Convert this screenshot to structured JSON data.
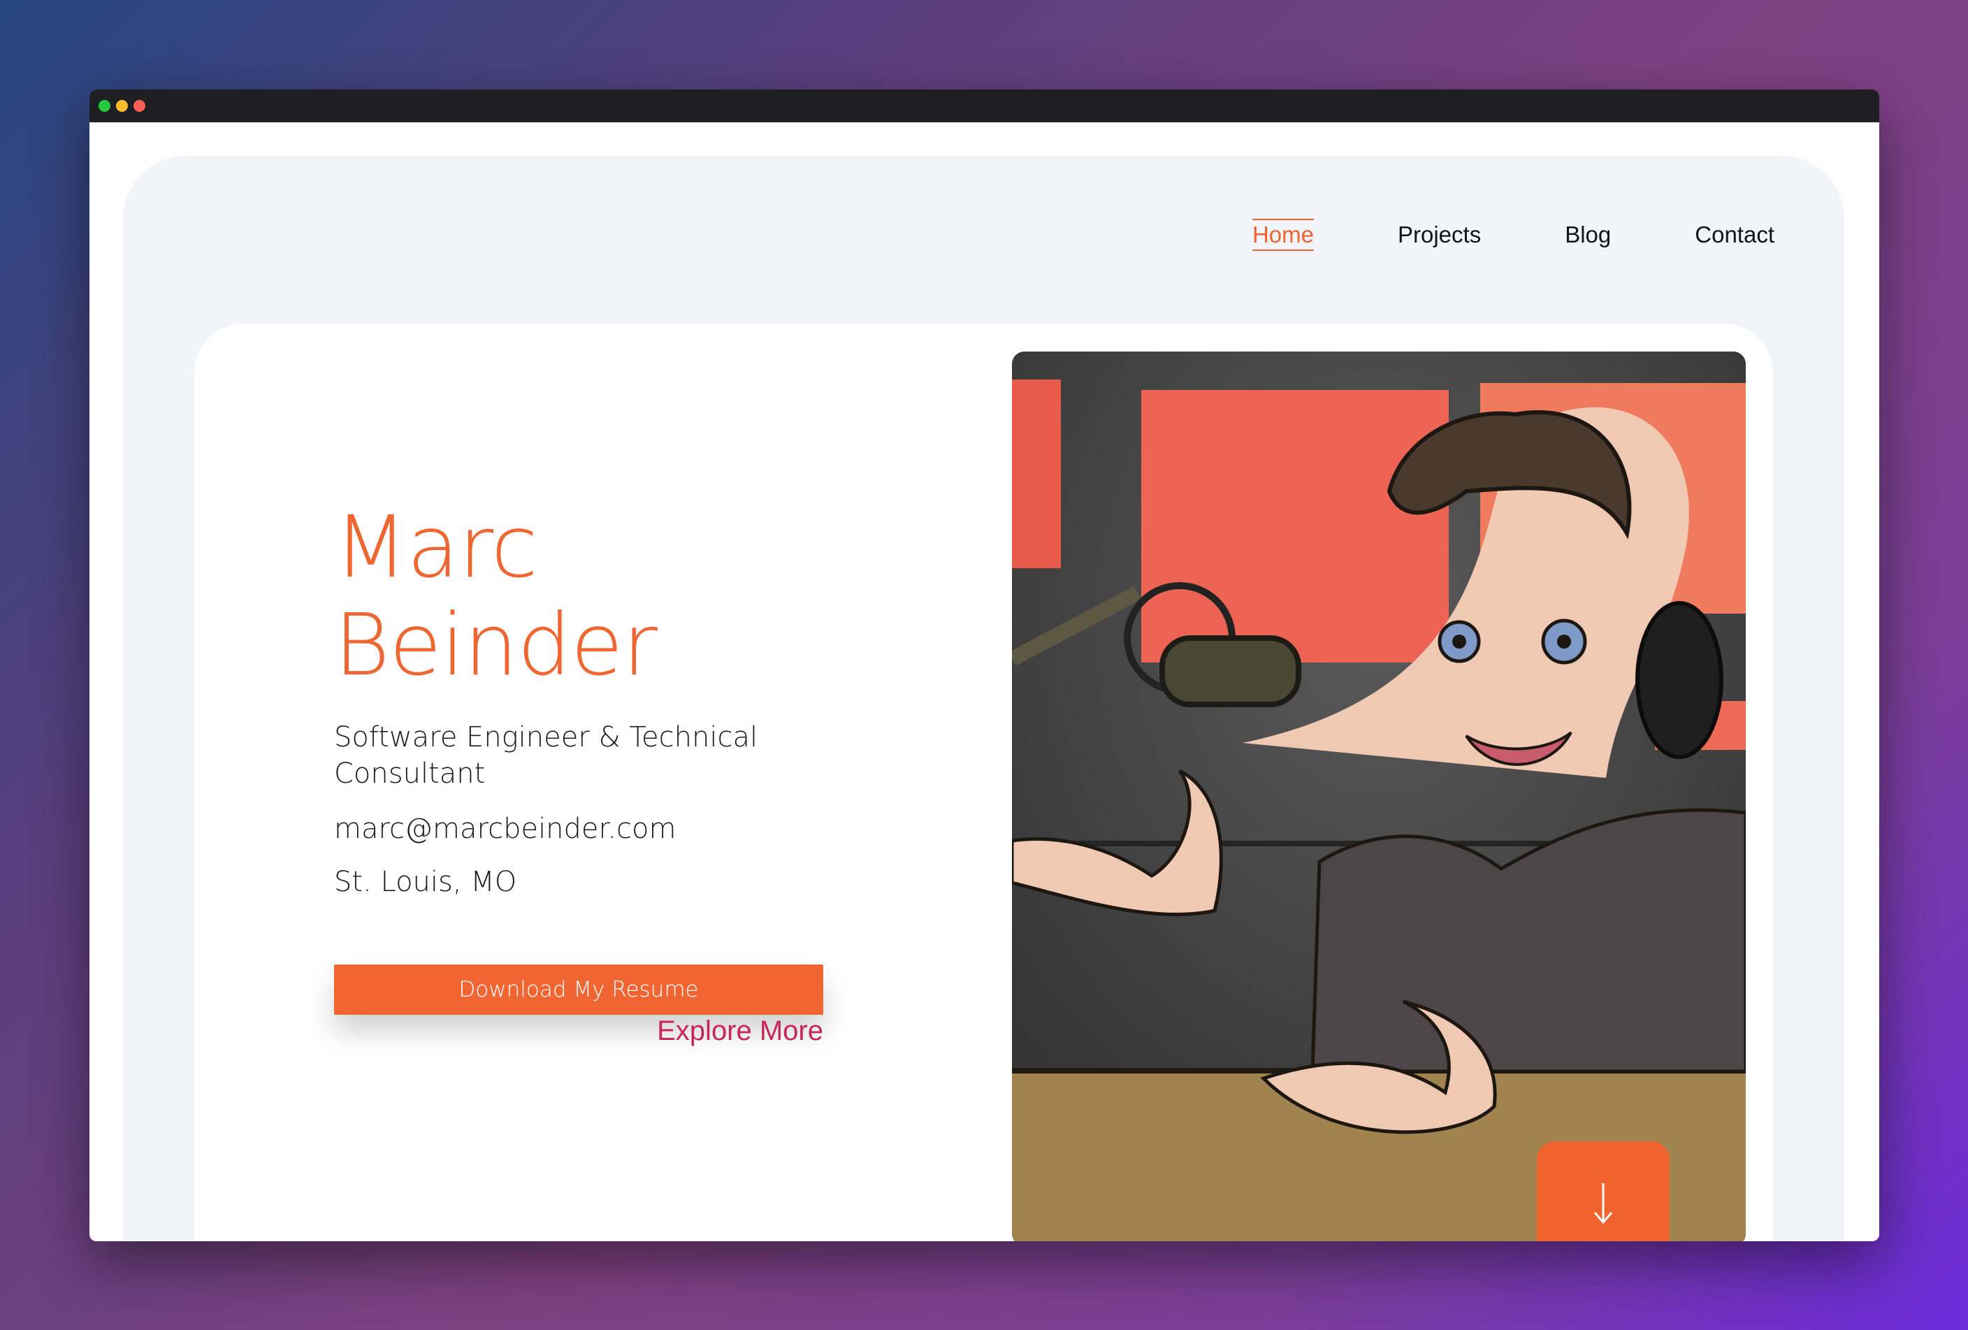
{
  "window": {
    "traffic_lights": {
      "close": "#27c93f",
      "minimize": "#ffbd2e",
      "maximize": "#ff5f56"
    }
  },
  "nav": {
    "items": [
      {
        "label": "Home",
        "active": true
      },
      {
        "label": "Projects",
        "active": false
      },
      {
        "label": "Blog",
        "active": false
      },
      {
        "label": "Contact",
        "active": false
      }
    ]
  },
  "hero": {
    "first_name": "Marc",
    "last_name": "Beinder",
    "title": "Software Engineer & Technical Consultant",
    "email": "marc@marcbeinder.com",
    "location": "St. Louis, MO",
    "resume_button": "Download My Resume",
    "explore_link": "Explore More",
    "portrait_icon": "cartoon-portrait-podcaster",
    "scroll_icon": "arrow-down-icon"
  },
  "colors": {
    "accent": "#f0632e",
    "link": "#c8265a",
    "page_bg": "#f1f5f9"
  }
}
